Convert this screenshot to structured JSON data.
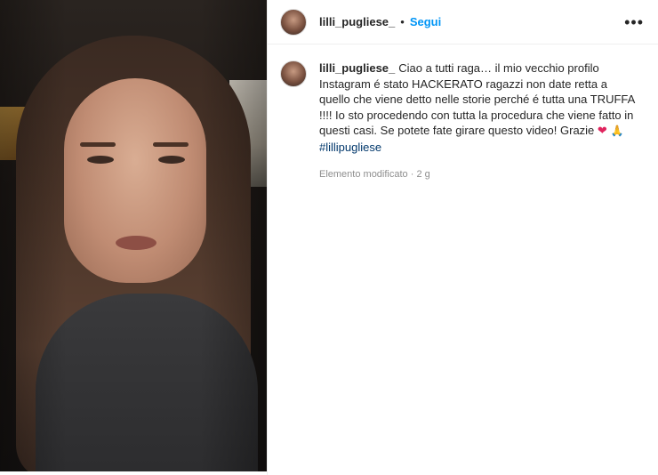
{
  "header": {
    "username": "lilli_pugliese_",
    "separator": "•",
    "follow_label": "Segui",
    "more_label": "•••"
  },
  "caption": {
    "username": "lilli_pugliese_",
    "text": "Ciao a tutti raga… il mio vecchio profilo Instagram é stato HACKERATO ragazzi non date retta a quello che viene detto nelle storie perché é tutta una TRUFFA !!!! Io sto procedendo con tutta la procedura che viene fatto in questi casi. Se potete fate girare questo video! Grazie",
    "emoji_heart": "❤",
    "emoji_person": "🙏",
    "hashtag": "#lillipugliese"
  },
  "meta": {
    "edited_label": "Elemento modificato",
    "separator": "·",
    "time": "2 g"
  },
  "colors": {
    "follow": "#0095f6",
    "hashtag": "#00376b",
    "heart": "#e0245e",
    "meta": "#8e8e8e"
  }
}
